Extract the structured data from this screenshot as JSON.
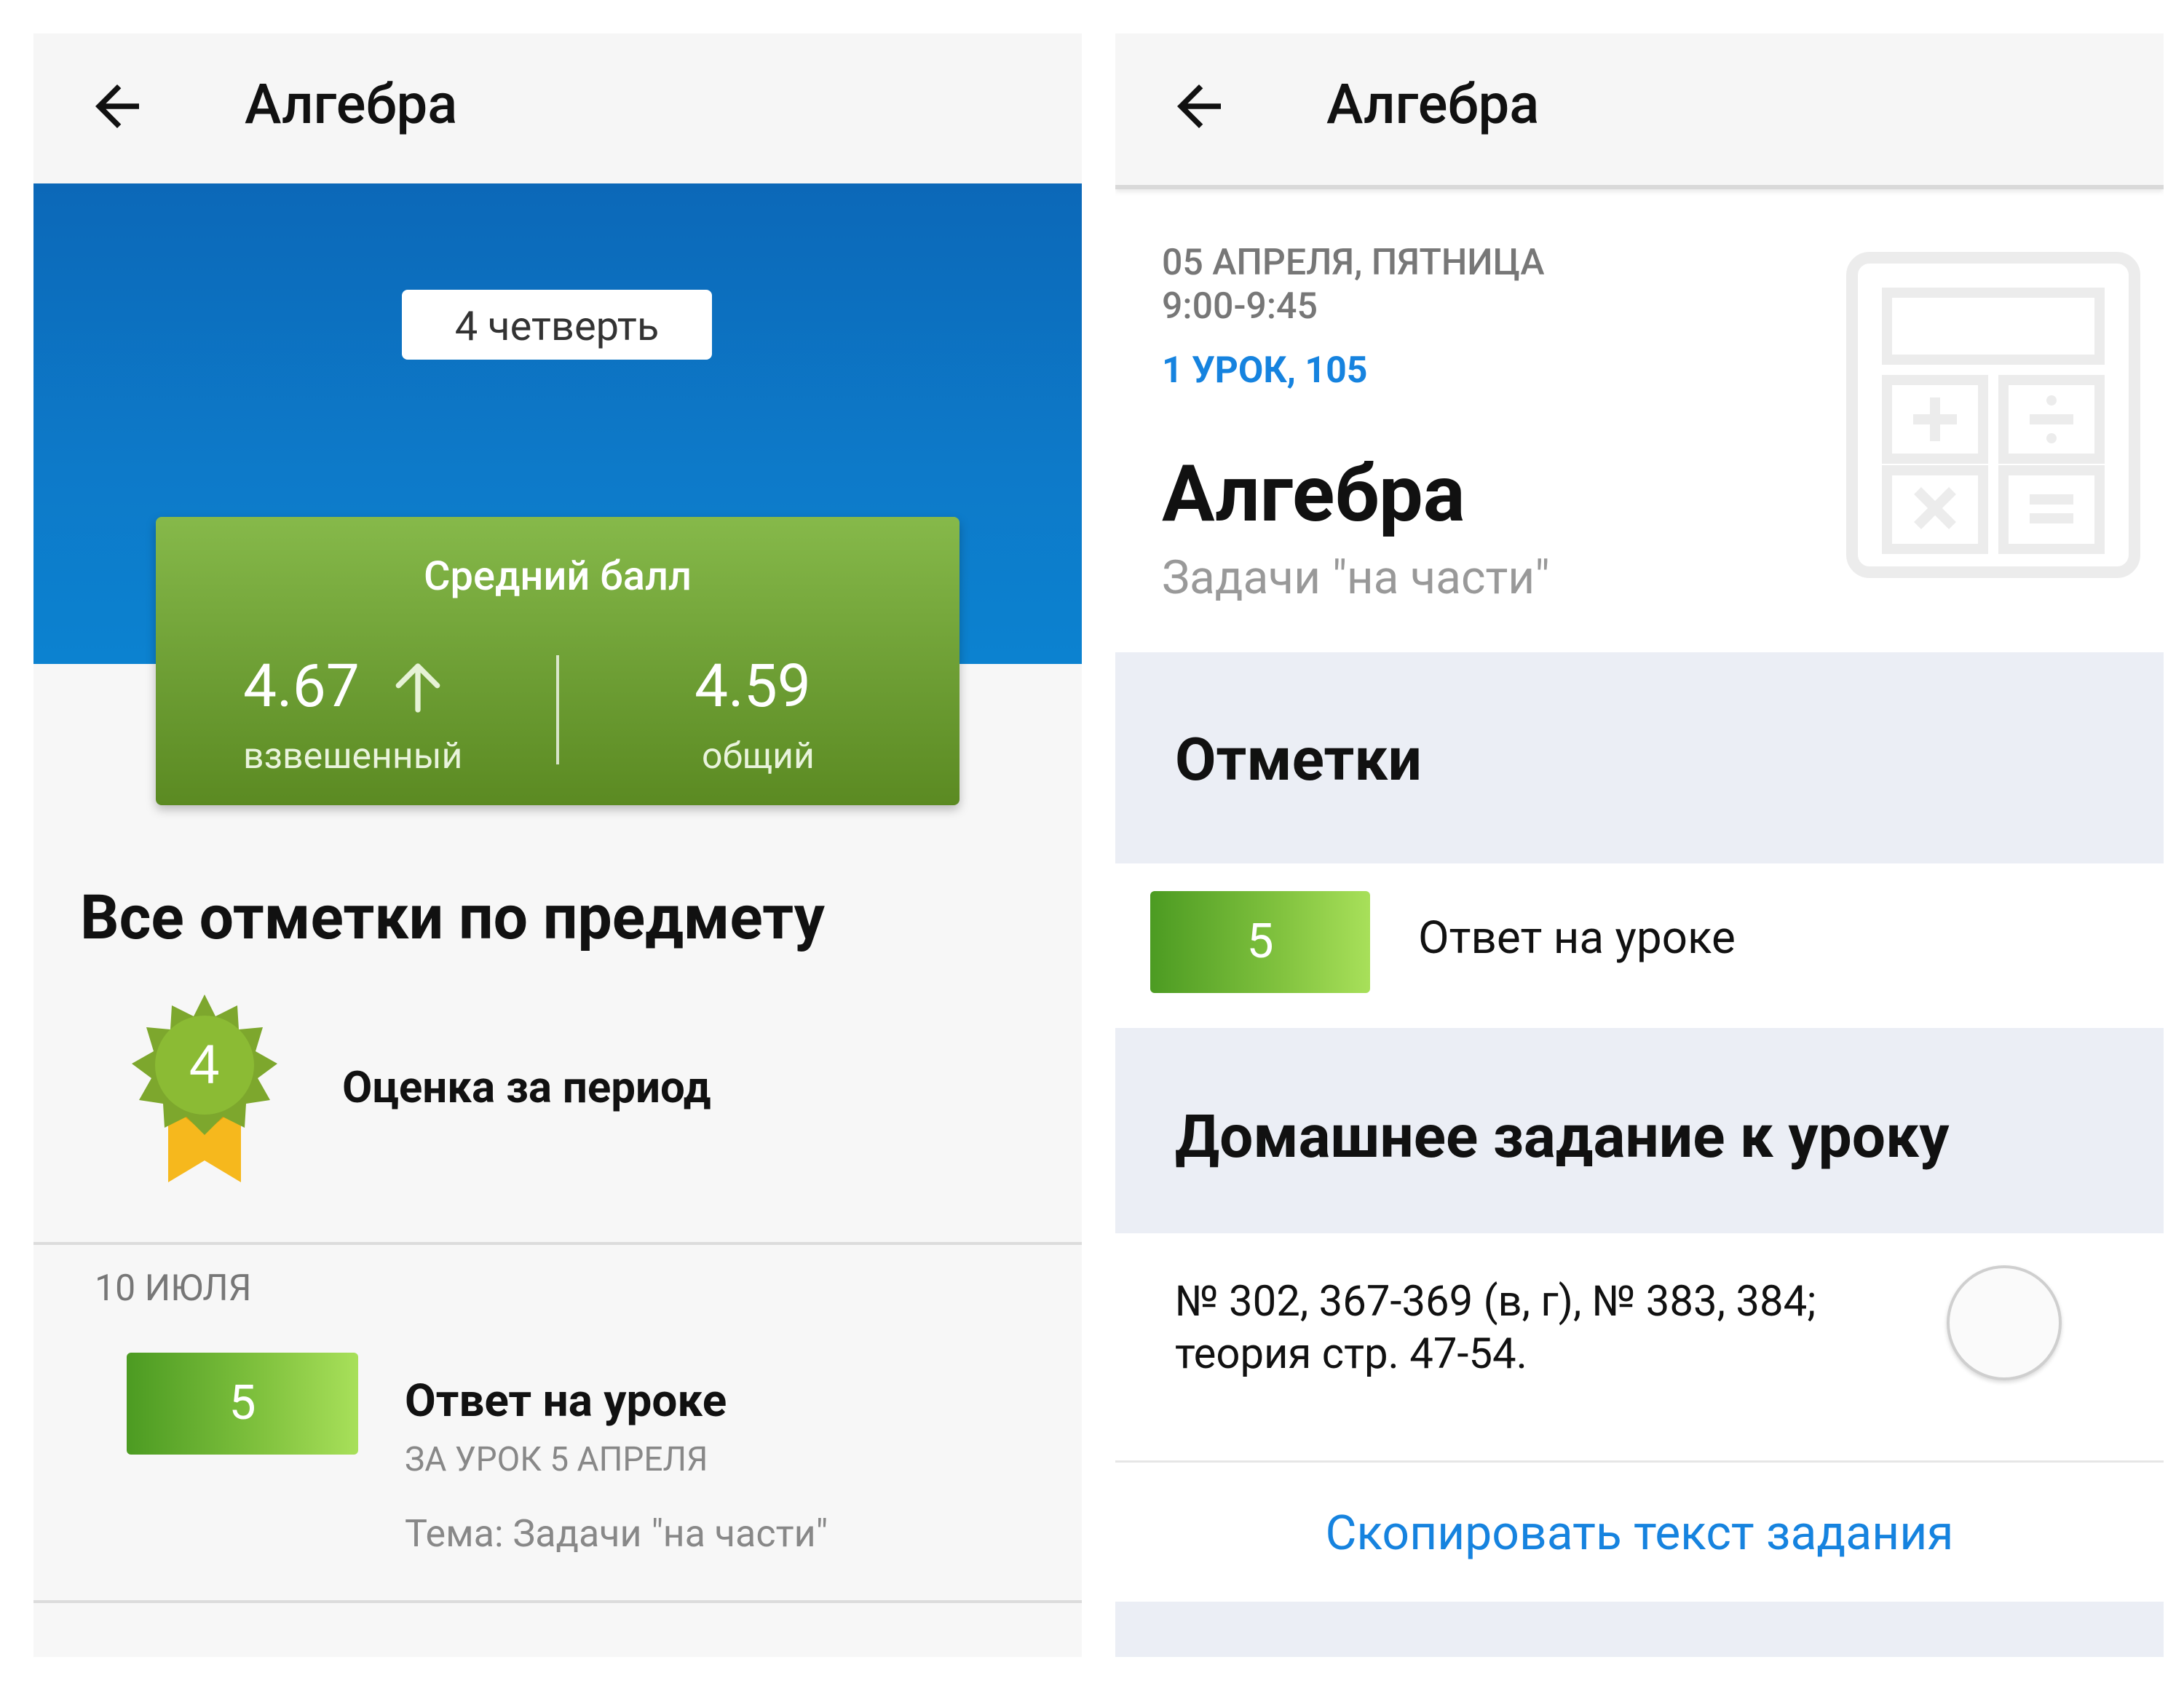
{
  "left": {
    "toolbar": {
      "title": "Алгебра"
    },
    "quarter_label": "4 четверть",
    "average": {
      "title": "Средний балл",
      "weighted_value": "4.67",
      "weighted_label": "взвешенный",
      "overall_value": "4.59",
      "overall_label": "общий",
      "trend": "up"
    },
    "all_marks_heading": "Все отметки по предмету",
    "period_grade": {
      "value": "4",
      "label": "Оценка за период"
    },
    "entries": [
      {
        "date": "10 ИЮЛЯ",
        "grade": "5",
        "title": "Ответ на уроке",
        "subtitle": "ЗА УРОК 5 АПРЕЛЯ",
        "theme": "Тема: Задачи \"на части\""
      }
    ]
  },
  "right": {
    "toolbar": {
      "title": "Алгебра"
    },
    "lesson": {
      "date": "05 АПРЕЛЯ, ПЯТНИЦА",
      "time": "9:00-9:45",
      "number_room": "1 УРОК, 105",
      "subject": "Алгебра",
      "topic": "Задачи \"на части\""
    },
    "marks_section": {
      "title": "Отметки",
      "items": [
        {
          "grade": "5",
          "label": "Ответ на уроке"
        }
      ]
    },
    "homework_section": {
      "title": "Домашнее задание к уроку",
      "text_line1": "№ 302, 367-369 (в, г), № 383, 384;",
      "text_line2": "теория стр. 47-54.",
      "done": false
    },
    "copy_link": "Скопировать текст задания"
  },
  "colors": {
    "hero_blue": "#0d7ac9",
    "avg_green": "#6d9e34",
    "grade_green": "#82c33f",
    "accent_blue": "#1683df",
    "section_bg": "#ebeef5"
  },
  "icons": [
    "back-arrow-icon",
    "arrow-up-icon",
    "badge-icon",
    "calculator-icon",
    "checkbox-circle-icon"
  ]
}
